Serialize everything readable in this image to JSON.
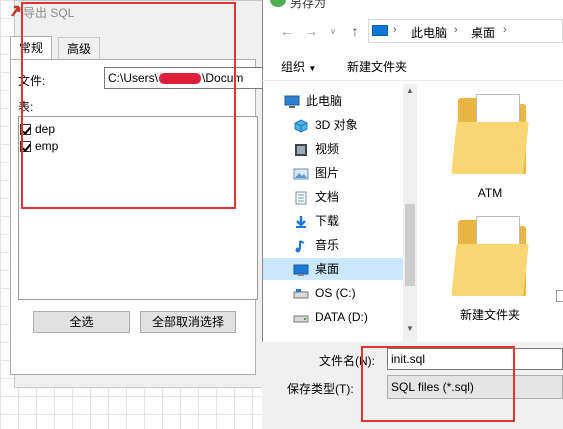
{
  "export_dialog": {
    "title": "导出 SQL",
    "tabs": [
      "常规",
      "高级"
    ],
    "file_label": "文件:",
    "file_path_prefix": "C:\\Users\\",
    "file_path_suffix": "\\Docum",
    "tables_label": "表:",
    "tables": [
      {
        "name": "dep",
        "checked": true
      },
      {
        "name": "emp",
        "checked": true
      }
    ],
    "select_all_button": "全选",
    "deselect_all_button": "全部取消选择"
  },
  "save_as_dialog": {
    "title": "另存为",
    "breadcrumb": [
      "此电脑",
      "桌面"
    ],
    "toolbar": {
      "organize_label": "组织",
      "new_folder_label": "新建文件夹"
    },
    "nav_items": [
      {
        "label": "此电脑",
        "icon": "computer-icon"
      },
      {
        "label": "3D 对象",
        "icon": "cube-3d-icon"
      },
      {
        "label": "视频",
        "icon": "video-icon"
      },
      {
        "label": "图片",
        "icon": "pictures-icon"
      },
      {
        "label": "文档",
        "icon": "documents-icon"
      },
      {
        "label": "下载",
        "icon": "download-icon"
      },
      {
        "label": "音乐",
        "icon": "music-icon"
      },
      {
        "label": "桌面",
        "icon": "desktop-icon"
      },
      {
        "label": "OS (C:)",
        "icon": "drive-c-icon"
      },
      {
        "label": "DATA (D:)",
        "icon": "drive-d-icon"
      }
    ],
    "selected_nav": "桌面",
    "files": [
      {
        "name": "ATM",
        "icon": "folder-icon"
      },
      {
        "name": "新建文件夹",
        "icon": "folder-icon"
      }
    ],
    "filename_label": "文件名(N):",
    "filename_value": "init.sql",
    "filetype_label": "保存类型(T):",
    "filetype_value": "SQL files (*.sql)"
  },
  "colors": {
    "annotation_red": "#e03535",
    "folder_yellow": "#f7d673",
    "selection_blue": "#cce8ff"
  }
}
